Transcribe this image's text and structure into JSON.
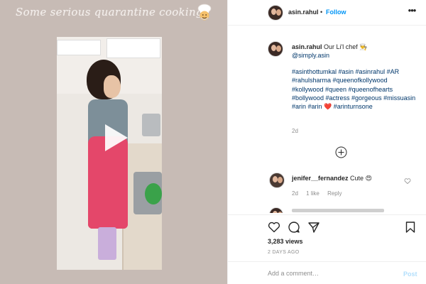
{
  "media": {
    "overlay_text": "Some serious quarantine cooking",
    "sticker_icon": "chef-emoji-icon",
    "play_icon": "play-icon"
  },
  "header": {
    "username": "asin.rahul",
    "separator": "•",
    "follow_label": "Follow",
    "more_icon": "more-options-icon",
    "more_label": "•••"
  },
  "caption": {
    "username": "asin.rahul",
    "text": "Our Li'l chef 👨‍🍳",
    "mention": "@simply.asin",
    "hashtags": "#asinthottumkal #asin #asinrahul #AR #rahulsharma #queenofkollywood #kollywood #queen #queenofhearts #bollywood #actress #gorgeous #missuasin #arin #arin ❤️ #arinturnsone",
    "time": "2d"
  },
  "load_more_icon": "plus-circle-icon",
  "comment": {
    "username": "jenifer__fernandez",
    "text": "Cute 😍",
    "time": "2d",
    "likes": "1 like",
    "reply_label": "Reply"
  },
  "actions": {
    "like_icon": "heart-icon",
    "comment_icon": "comment-icon",
    "share_icon": "share-icon",
    "save_icon": "bookmark-icon",
    "views": "3,283 views",
    "posted": "2 DAYS AGO"
  },
  "add_comment": {
    "placeholder": "Add a comment…",
    "post_label": "Post"
  },
  "colors": {
    "link_blue": "#0095f6",
    "hashtag_blue": "#00376b",
    "post_disabled": "#b2dffc",
    "muted_gray": "#8e8e8e",
    "media_bg": "#c7bbb5"
  }
}
